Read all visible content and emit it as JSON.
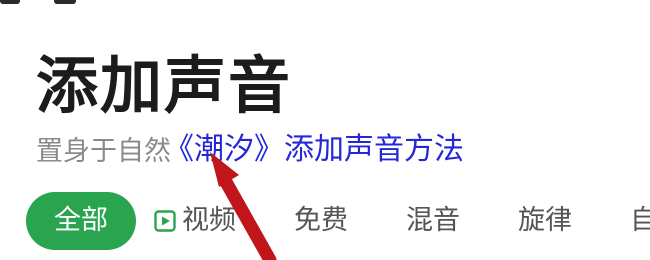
{
  "header": {
    "title": "添加声音",
    "subtitle": "置身于自然"
  },
  "overlay": {
    "caption": "《潮汐》添加声音方法"
  },
  "tabs": {
    "items": [
      {
        "label": "全部"
      },
      {
        "label": "视频",
        "icon": "play-icon"
      },
      {
        "label": "免费"
      },
      {
        "label": "混音"
      },
      {
        "label": "旋律"
      },
      {
        "label": "自"
      }
    ],
    "active_index": 0
  },
  "colors": {
    "accent": "#2aa44f",
    "caption": "#2427d8",
    "arrow": "#c0151b",
    "title": "#1c1c1c",
    "subtitle": "#8a8a8a"
  }
}
